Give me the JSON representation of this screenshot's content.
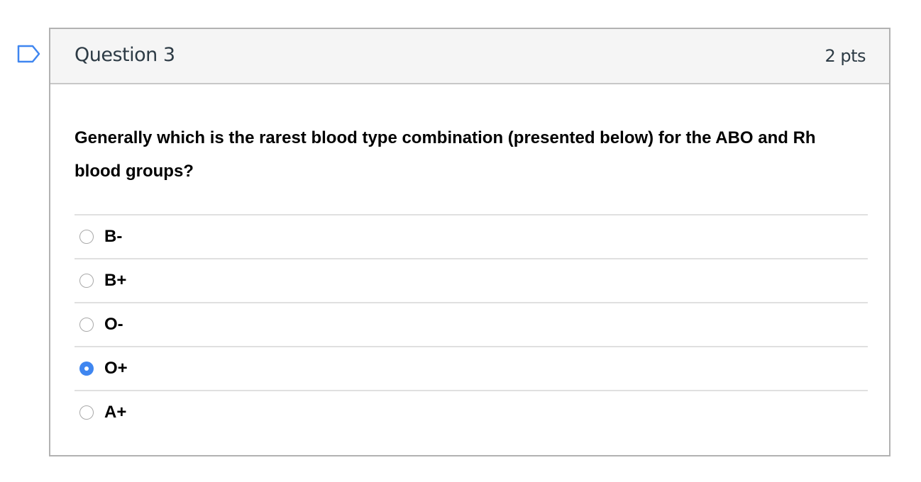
{
  "flag_icon": "bookmark-flag-icon",
  "question": {
    "title": "Question 3",
    "points": "2 pts",
    "text": "Generally which is the rarest blood type combination (presented below) for the ABO and Rh blood groups?"
  },
  "answers": [
    {
      "label": "B-",
      "selected": false
    },
    {
      "label": "B+",
      "selected": false
    },
    {
      "label": "O-",
      "selected": false
    },
    {
      "label": "O+",
      "selected": true
    },
    {
      "label": "A+",
      "selected": false
    }
  ],
  "colors": {
    "radio_selected": "#3f86f0",
    "flag_outline": "#3f86f0",
    "header_bg": "#f5f5f5",
    "border": "#b2b2b2"
  }
}
